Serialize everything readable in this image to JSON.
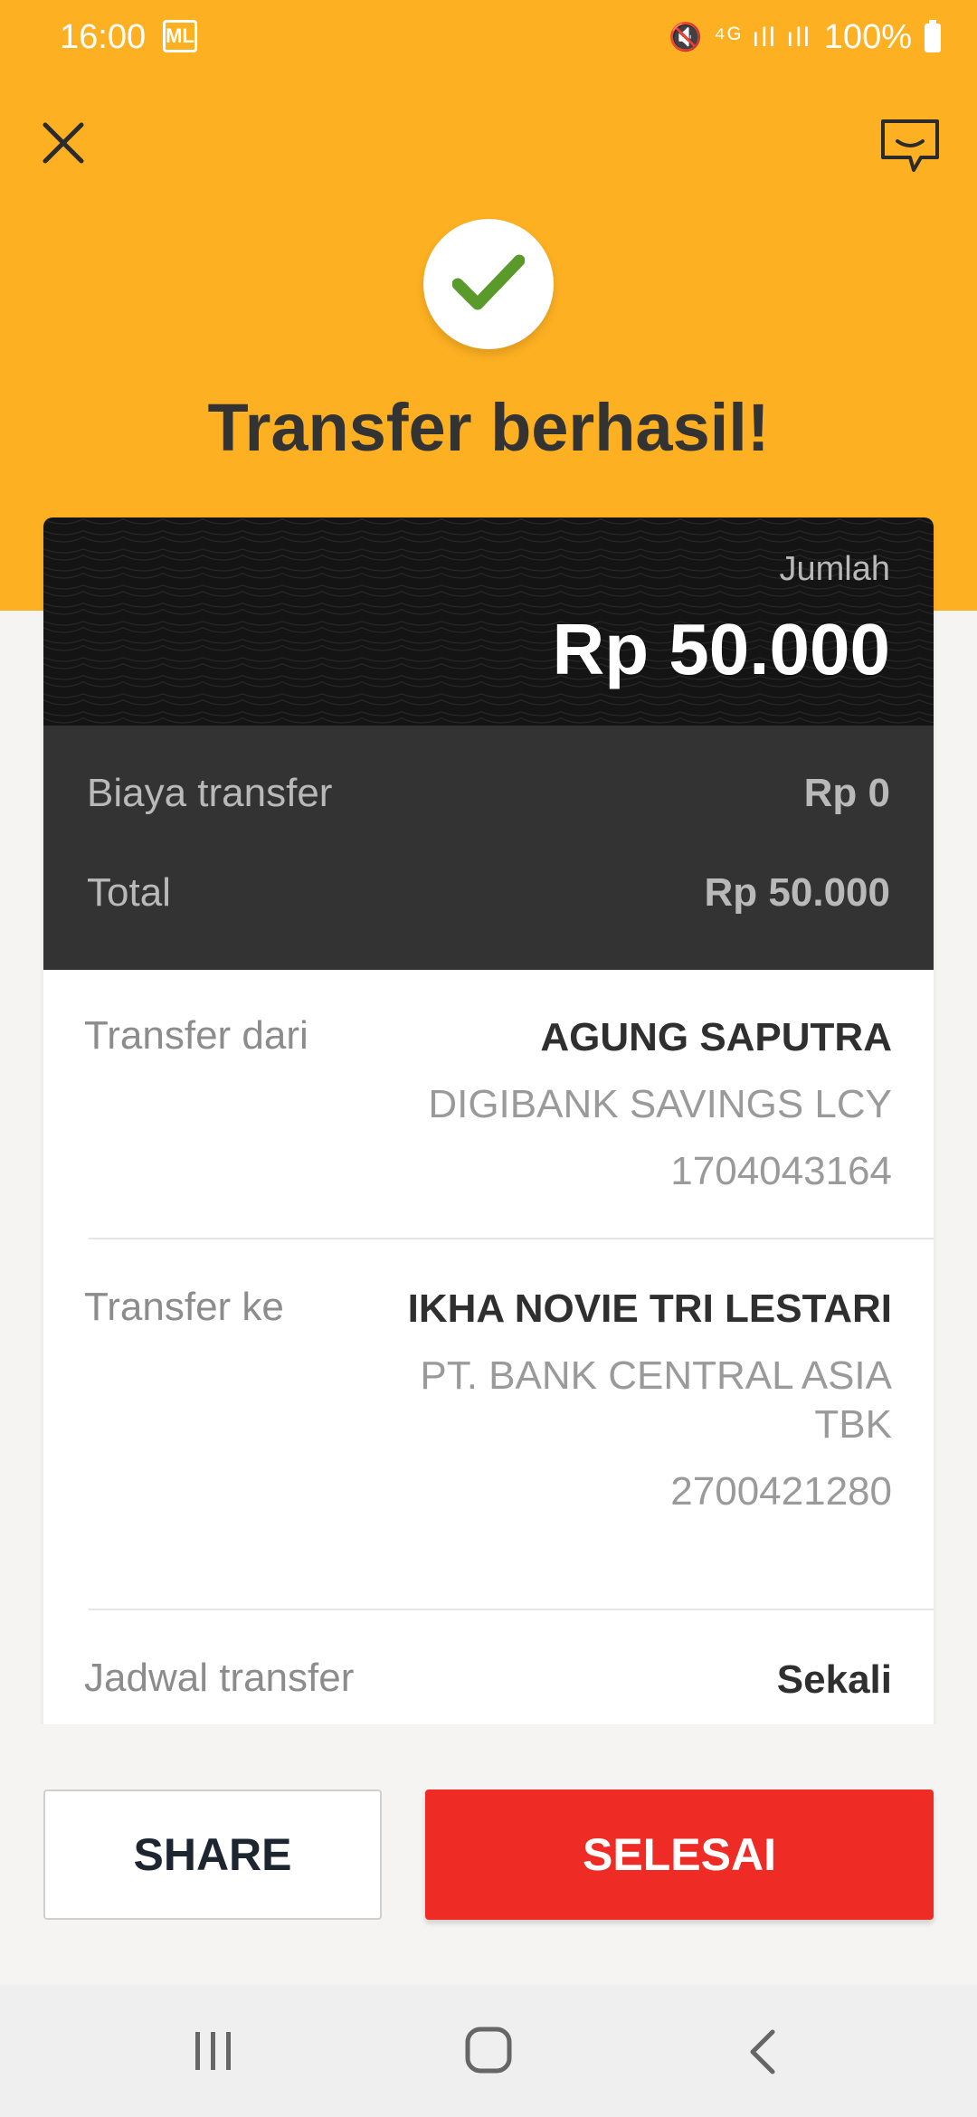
{
  "status_bar": {
    "time": "16:00",
    "carrier_icon": "ML",
    "signal_icons": "🔇 ⁴ᴳ ıll ıll",
    "battery": "100%"
  },
  "header": {
    "close_icon": "close-icon",
    "chat_icon": "chat-icon",
    "success_icon": "checkmark-icon",
    "title": "Transfer berhasil!"
  },
  "amount": {
    "label": "Jumlah",
    "value": "Rp 50.000"
  },
  "fees": {
    "fee_label": "Biaya transfer",
    "fee_value": "Rp 0",
    "total_label": "Total",
    "total_value": "Rp 50.000"
  },
  "details": {
    "from": {
      "label": "Transfer dari",
      "name": "AGUNG SAPUTRA",
      "bank": "DIGIBANK SAVINGS LCY",
      "account": "1704043164"
    },
    "to": {
      "label": "Transfer ke",
      "name": "IKHA NOVIE TRI LESTARI",
      "bank": "PT. BANK CENTRAL ASIA TBK",
      "account": "2700421280"
    },
    "schedule": {
      "label": "Jadwal transfer",
      "value": "Sekali"
    }
  },
  "actions": {
    "share_label": "SHARE",
    "done_label": "SELESAI"
  },
  "colors": {
    "header_bg": "#fdb022",
    "primary_button": "#ee2b24",
    "check_color": "#5a9a2a"
  }
}
